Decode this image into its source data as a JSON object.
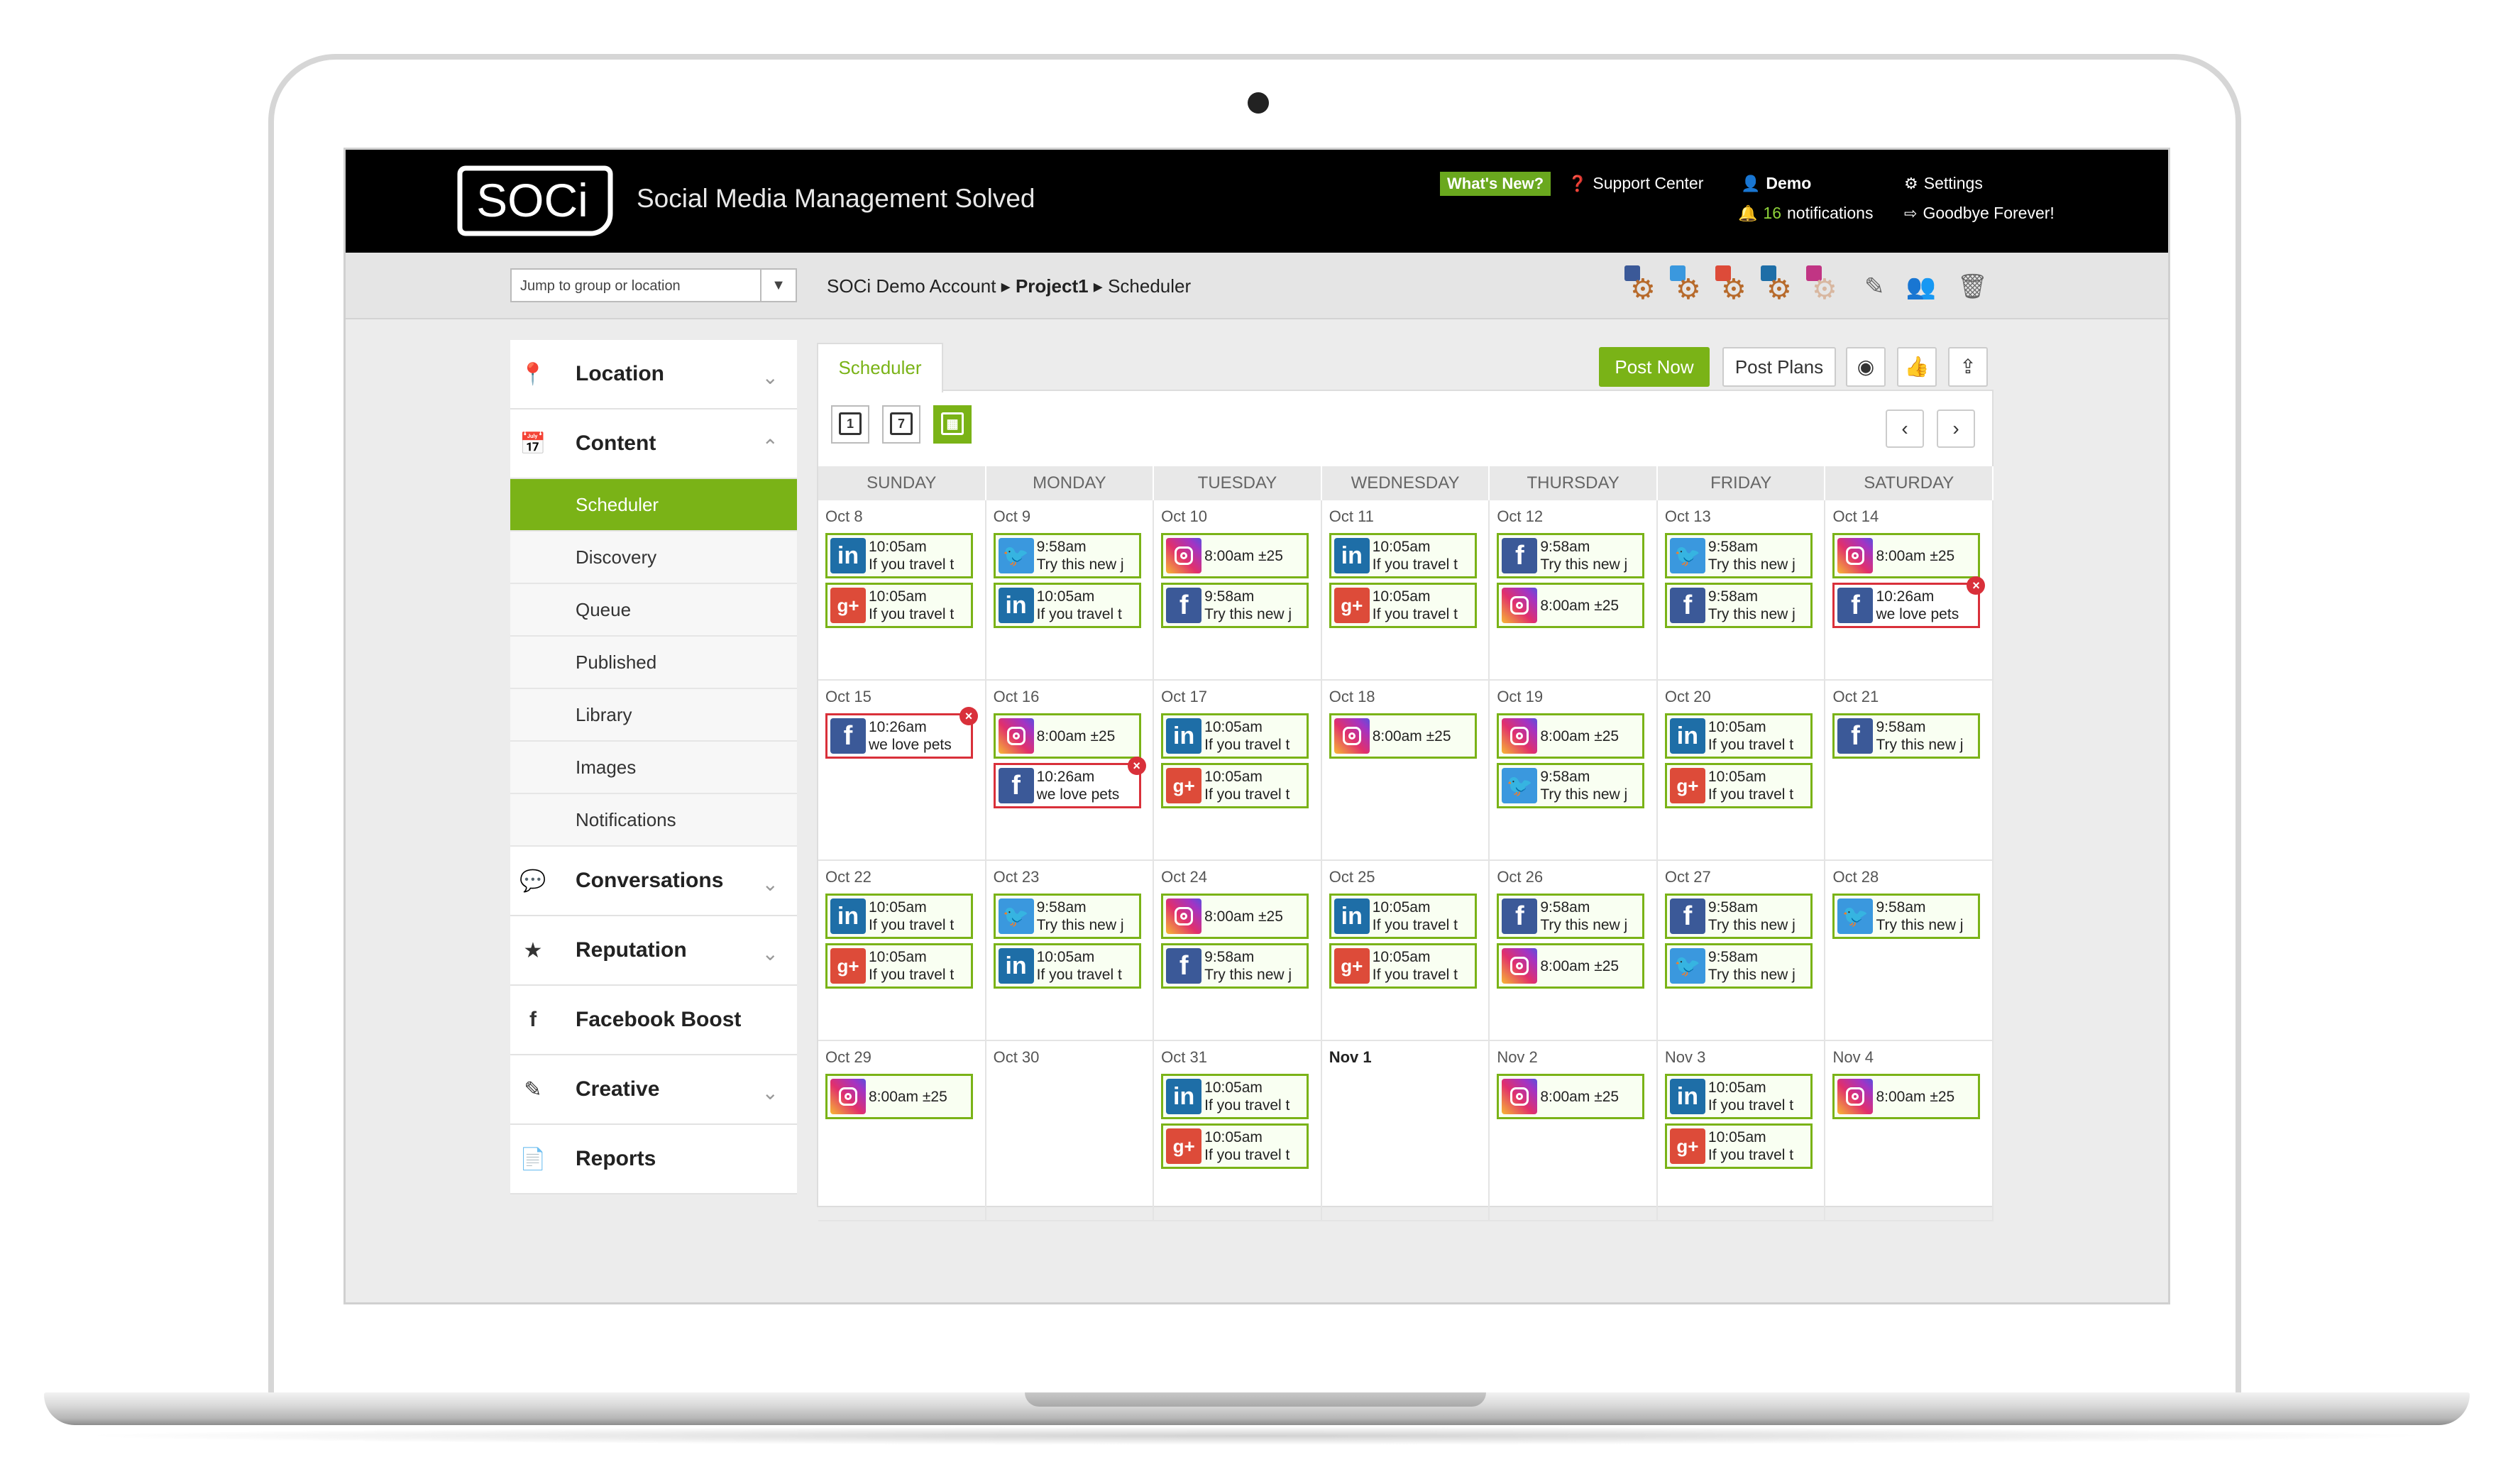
{
  "header": {
    "logo_text": "SOCi",
    "tagline": "Social Media Management Solved",
    "whats_new": "What's New?",
    "support": "Support Center",
    "user": "Demo",
    "notifications_count": "16",
    "notifications_label": "notifications",
    "settings": "Settings",
    "logout": "Goodbye Forever!"
  },
  "bar": {
    "jump_placeholder": "Jump to group or location",
    "crumb_account": "SOCi Demo Account",
    "crumb_project": "Project1",
    "crumb_page": "Scheduler"
  },
  "sidebar": {
    "location": "Location",
    "content": "Content",
    "sub_items": [
      "Scheduler",
      "Discovery",
      "Queue",
      "Published",
      "Library",
      "Images",
      "Notifications"
    ],
    "conversations": "Conversations",
    "reputation": "Reputation",
    "facebook_boost": "Facebook Boost",
    "creative": "Creative",
    "reports": "Reports"
  },
  "main": {
    "tab": "Scheduler",
    "post_now": "Post Now",
    "post_plans": "Post Plans",
    "view_day": "1",
    "view_week": "7",
    "prev": "‹",
    "next": "›",
    "days": [
      "SUNDAY",
      "MONDAY",
      "TUESDAY",
      "WEDNESDAY",
      "THURSDAY",
      "FRIDAY",
      "SATURDAY"
    ]
  },
  "calendar": [
    [
      {
        "date": "Oct 8",
        "posts": [
          {
            "net": "linkedin",
            "time": "10:05am",
            "text": "If you travel t"
          },
          {
            "net": "googleplus",
            "time": "10:05am",
            "text": "If you travel t"
          }
        ]
      },
      {
        "date": "Oct 9",
        "posts": [
          {
            "net": "twitter",
            "time": "9:58am",
            "text": "Try this new j"
          },
          {
            "net": "linkedin",
            "time": "10:05am",
            "text": "If you travel t"
          }
        ]
      },
      {
        "date": "Oct 10",
        "posts": [
          {
            "net": "instagram",
            "time": "8:00am ±25",
            "text": ""
          },
          {
            "net": "facebook",
            "time": "9:58am",
            "text": "Try this new j"
          }
        ]
      },
      {
        "date": "Oct 11",
        "posts": [
          {
            "net": "linkedin",
            "time": "10:05am",
            "text": "If you travel t"
          },
          {
            "net": "googleplus",
            "time": "10:05am",
            "text": "If you travel t"
          }
        ]
      },
      {
        "date": "Oct 12",
        "posts": [
          {
            "net": "facebook",
            "time": "9:58am",
            "text": "Try this new j"
          },
          {
            "net": "instagram",
            "time": "8:00am ±25",
            "text": ""
          }
        ]
      },
      {
        "date": "Oct 13",
        "posts": [
          {
            "net": "twitter",
            "time": "9:58am",
            "text": "Try this new j"
          },
          {
            "net": "facebook",
            "time": "9:58am",
            "text": "Try this new j"
          }
        ]
      },
      {
        "date": "Oct 14",
        "posts": [
          {
            "net": "instagram",
            "time": "8:00am ±25",
            "text": ""
          },
          {
            "net": "facebook",
            "time": "10:26am",
            "text": "we love pets",
            "error": true
          }
        ]
      }
    ],
    [
      {
        "date": "Oct 15",
        "posts": [
          {
            "net": "facebook",
            "time": "10:26am",
            "text": "we love pets",
            "error": true
          }
        ]
      },
      {
        "date": "Oct 16",
        "posts": [
          {
            "net": "instagram",
            "time": "8:00am ±25",
            "text": ""
          },
          {
            "net": "facebook",
            "time": "10:26am",
            "text": "we love pets",
            "error": true
          }
        ]
      },
      {
        "date": "Oct 17",
        "posts": [
          {
            "net": "linkedin",
            "time": "10:05am",
            "text": "If you travel t"
          },
          {
            "net": "googleplus",
            "time": "10:05am",
            "text": "If you travel t"
          }
        ]
      },
      {
        "date": "Oct 18",
        "posts": [
          {
            "net": "instagram",
            "time": "8:00am ±25",
            "text": ""
          }
        ]
      },
      {
        "date": "Oct 19",
        "posts": [
          {
            "net": "instagram",
            "time": "8:00am ±25",
            "text": ""
          },
          {
            "net": "twitter",
            "time": "9:58am",
            "text": "Try this new j"
          }
        ]
      },
      {
        "date": "Oct 20",
        "posts": [
          {
            "net": "linkedin",
            "time": "10:05am",
            "text": "If you travel t"
          },
          {
            "net": "googleplus",
            "time": "10:05am",
            "text": "If you travel t"
          }
        ]
      },
      {
        "date": "Oct 21",
        "posts": [
          {
            "net": "facebook",
            "time": "9:58am",
            "text": "Try this new j"
          }
        ]
      }
    ],
    [
      {
        "date": "Oct 22",
        "posts": [
          {
            "net": "linkedin",
            "time": "10:05am",
            "text": "If you travel t"
          },
          {
            "net": "googleplus",
            "time": "10:05am",
            "text": "If you travel t"
          }
        ]
      },
      {
        "date": "Oct 23",
        "posts": [
          {
            "net": "twitter",
            "time": "9:58am",
            "text": "Try this new j"
          },
          {
            "net": "linkedin",
            "time": "10:05am",
            "text": "If you travel t"
          }
        ]
      },
      {
        "date": "Oct 24",
        "posts": [
          {
            "net": "instagram",
            "time": "8:00am ±25",
            "text": ""
          },
          {
            "net": "facebook",
            "time": "9:58am",
            "text": "Try this new j"
          }
        ]
      },
      {
        "date": "Oct 25",
        "posts": [
          {
            "net": "linkedin",
            "time": "10:05am",
            "text": "If you travel t"
          },
          {
            "net": "googleplus",
            "time": "10:05am",
            "text": "If you travel t"
          }
        ]
      },
      {
        "date": "Oct 26",
        "posts": [
          {
            "net": "facebook",
            "time": "9:58am",
            "text": "Try this new j"
          },
          {
            "net": "instagram",
            "time": "8:00am ±25",
            "text": ""
          }
        ]
      },
      {
        "date": "Oct 27",
        "posts": [
          {
            "net": "facebook",
            "time": "9:58am",
            "text": "Try this new j"
          },
          {
            "net": "twitter",
            "time": "9:58am",
            "text": "Try this new j"
          }
        ]
      },
      {
        "date": "Oct 28",
        "posts": [
          {
            "net": "twitter",
            "time": "9:58am",
            "text": "Try this new j"
          }
        ]
      }
    ],
    [
      {
        "date": "Oct 29",
        "posts": [
          {
            "net": "instagram",
            "time": "8:00am ±25",
            "text": ""
          }
        ]
      },
      {
        "date": "Oct 30",
        "posts": []
      },
      {
        "date": "Oct 31",
        "posts": [
          {
            "net": "linkedin",
            "time": "10:05am",
            "text": "If you travel t"
          },
          {
            "net": "googleplus",
            "time": "10:05am",
            "text": "If you travel t"
          }
        ]
      },
      {
        "date": "Nov 1",
        "bold": true,
        "posts": []
      },
      {
        "date": "Nov 2",
        "posts": [
          {
            "net": "instagram",
            "time": "8:00am ±25",
            "text": ""
          }
        ]
      },
      {
        "date": "Nov 3",
        "posts": [
          {
            "net": "linkedin",
            "time": "10:05am",
            "text": "If you travel t"
          },
          {
            "net": "googleplus",
            "time": "10:05am",
            "text": "If you travel t"
          }
        ]
      },
      {
        "date": "Nov 4",
        "posts": [
          {
            "net": "instagram",
            "time": "8:00am ±25",
            "text": ""
          }
        ]
      }
    ]
  ],
  "colors": {
    "accent": "#7ab317",
    "header_bg": "#000000",
    "error": "#d9303a"
  }
}
